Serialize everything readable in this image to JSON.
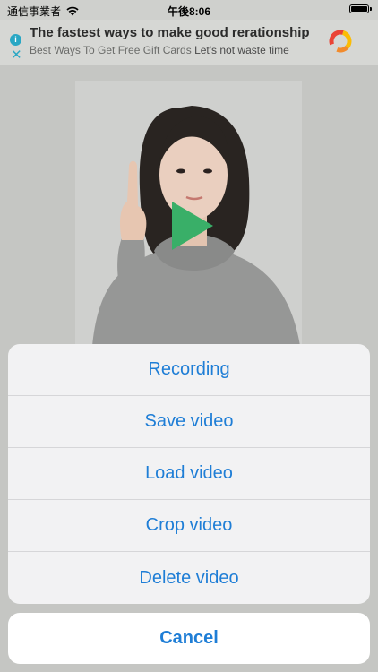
{
  "status_bar": {
    "carrier": "通信事業者",
    "time": "午後8:06",
    "battery_level": 1.0
  },
  "ad": {
    "title": "The fastest ways to make good rerationship",
    "subtitle": "Best Ways To Get Free Gift Cards",
    "subtitle_suffix": "Let's not waste time",
    "info_glyph": "i",
    "close_glyph": "✕"
  },
  "video": {
    "play_color": "#3bb36b"
  },
  "action_sheet": {
    "items": [
      "Recording",
      "Save video",
      "Load video",
      "Crop video",
      "Delete video"
    ],
    "cancel": "Cancel",
    "accent_color": "#1f7ed6"
  }
}
